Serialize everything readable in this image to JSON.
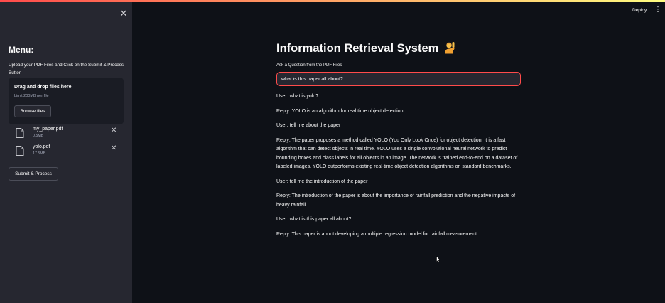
{
  "header": {
    "deploy_label": "Deploy",
    "menu_icon": "kebab-menu-icon"
  },
  "sidebar": {
    "close_icon": "close-icon",
    "menu_title": "Menu:",
    "description": "Upload your PDF Files and Click on the Submit & Process Button",
    "uploader": {
      "title": "Drag and drop files here",
      "limit": "Limit 200MB per file",
      "browse_label": "Browse files"
    },
    "files": [
      {
        "name": "my_paper.pdf",
        "size": "0.5MB"
      },
      {
        "name": "yolo.pdf",
        "size": "17.5MB"
      }
    ],
    "submit_label": "Submit & Process"
  },
  "main": {
    "title": "Information Retrieval System",
    "title_icon": "person-raising-hand-emoji",
    "question_label": "Ask a Question from the PDF Files",
    "question_value": "what is this paper all about?",
    "messages": [
      "User: what is yolo?",
      "Reply: YOLO is an algorithm for real time object detection",
      "User: tell me about the paper",
      "Reply: The paper proposes a method called YOLO (You Only Look Once) for object detection. It is a fast algorithm that can detect objects in real time. YOLO uses a single convolutional neural network to predict bounding boxes and class labels for all objects in an image. The network is trained end-to-end on a dataset of labeled images. YOLO outperforms existing real-time object detection algorithms on standard benchmarks.",
      "User: tell me the introduction of the paper",
      "Reply: The introduction of the paper is about the importance of rainfall prediction and the negative impacts of heavy rainfall.",
      "User: what is this paper all about?",
      "Reply: This paper is about developing a multiple regression model for rainfall measurement."
    ]
  },
  "colors": {
    "background": "#0e1117",
    "sidebar": "#262730",
    "accent": "#ff4b4b",
    "text": "#fafafa"
  }
}
